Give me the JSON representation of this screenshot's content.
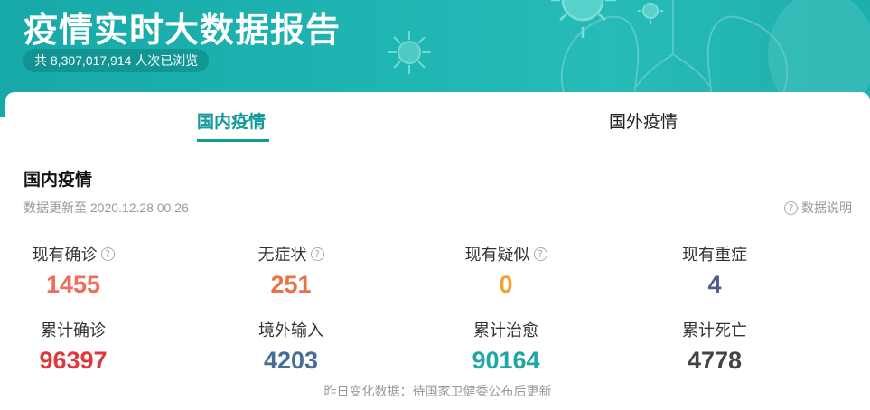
{
  "banner": {
    "title": "疫情实时大数据报告",
    "views_text": "共 8,307,017,914 人次已浏览"
  },
  "tabs": [
    {
      "label": "国内疫情",
      "active": true
    },
    {
      "label": "国外疫情",
      "active": false
    }
  ],
  "section": {
    "title": "国内疫情",
    "update_time": "数据更新至 2020.12.28 00:26",
    "help_label": "数据说明"
  },
  "stats": [
    {
      "label": "现有确诊",
      "value": "1455",
      "color": "#f06c5c",
      "has_help": true
    },
    {
      "label": "无症状",
      "value": "251",
      "color": "#e8714a",
      "has_help": true
    },
    {
      "label": "现有疑似",
      "value": "0",
      "color": "#f0a334",
      "has_help": true
    },
    {
      "label": "现有重症",
      "value": "4",
      "color": "#4f5c8c",
      "has_help": false
    },
    {
      "label": "累计确诊",
      "value": "96397",
      "color": "#e0373a",
      "has_help": false
    },
    {
      "label": "境外输入",
      "value": "4203",
      "color": "#466d9a",
      "has_help": false
    },
    {
      "label": "累计治愈",
      "value": "90164",
      "color": "#1fa6a6",
      "has_help": false
    },
    {
      "label": "累计死亡",
      "value": "4778",
      "color": "#444444",
      "has_help": false
    }
  ],
  "footnote": "昨日变化数据：待国家卫健委公布后更新",
  "colors": {
    "banner": "#1fb5b2",
    "accent": "#119a98"
  },
  "icons": {
    "help": "question-circle-icon",
    "decoration": "virus-icon"
  }
}
